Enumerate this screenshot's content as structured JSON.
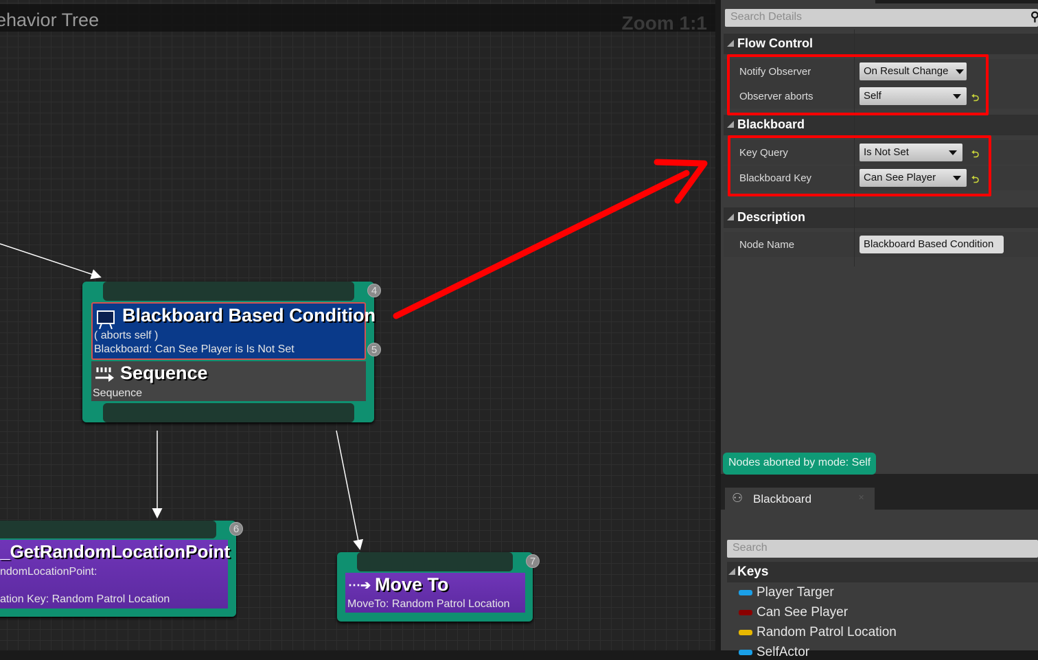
{
  "graph": {
    "title": "ehavior Tree",
    "zoom": "Zoom 1:1",
    "nodes": {
      "condition": {
        "title": "Blackboard Based Condition",
        "line1": "( aborts self )",
        "line2": "Blackboard: Can See Player is Is Not Set",
        "index_top": "4",
        "index": "5"
      },
      "sequence": {
        "title": "Sequence",
        "sub": "Sequence"
      },
      "task": {
        "title": "_GetRandomLocationPoint",
        "line1": "ndomLocationPoint:",
        "line2": "ation Key: Random Patrol Location",
        "index": "6"
      },
      "moveto": {
        "title": "Move To",
        "sub": "MoveTo: Random Patrol Location",
        "index": "7"
      }
    }
  },
  "details": {
    "search_placeholder": "Search Details",
    "sections": [
      {
        "title": "Flow Control",
        "rows": [
          {
            "label": "Notify Observer",
            "value": "On Result Change"
          },
          {
            "label": "Observer aborts",
            "value": "Self"
          }
        ]
      },
      {
        "title": "Blackboard",
        "rows": [
          {
            "label": "Key Query",
            "value": "Is Not Set"
          },
          {
            "label": "Blackboard Key",
            "value": "Can See Player"
          }
        ]
      },
      {
        "title": "Description",
        "rows": [
          {
            "label": "Node Name",
            "value": "Blackboard Based Condition"
          }
        ]
      }
    ],
    "status": "Nodes aborted by mode: Self"
  },
  "blackboard": {
    "tab": "Blackboard",
    "search_placeholder": "Search",
    "keys_header": "Keys",
    "keys": [
      {
        "name": "Player Targer",
        "color": "#1aa0e8"
      },
      {
        "name": "Can See Player",
        "color": "#8a0000"
      },
      {
        "name": "Random Patrol Location",
        "color": "#e8b800"
      },
      {
        "name": "SelfActor",
        "color": "#1aa0e8"
      }
    ]
  },
  "colors": {
    "node_border": "#0f9070",
    "decorator": "#0a3a8a",
    "composite": "#444444",
    "task": "#6a30b0",
    "highlight": "#ff0000"
  }
}
